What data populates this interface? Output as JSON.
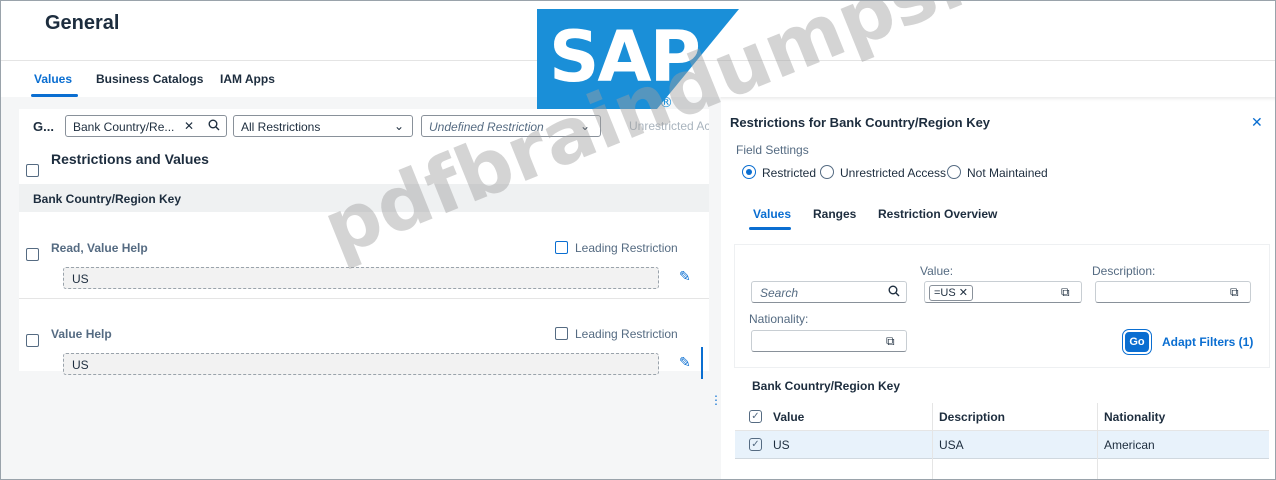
{
  "header": {
    "title": "General"
  },
  "tabs": [
    {
      "label": "Values",
      "active": true
    },
    {
      "label": "Business Catalogs",
      "active": false
    },
    {
      "label": "IAM Apps",
      "active": false
    }
  ],
  "left": {
    "group_label": "G...",
    "field_filter": "Bank Country/Re...",
    "restriction_filter": "All Restrictions",
    "restriction_type": "Undefined Restriction",
    "unrestricted_label": "Unrestricted Access",
    "list_title": "Restrictions and Values",
    "key_label": "Bank Country/Region Key",
    "rows": [
      {
        "label": "Read, Value Help",
        "leading": "Leading Restriction",
        "value": "US"
      },
      {
        "label": "Value Help",
        "leading": "Leading Restriction",
        "value": "US"
      }
    ]
  },
  "right": {
    "title": "Restrictions for Bank Country/Region Key",
    "field_settings_label": "Field Settings",
    "radios": [
      {
        "label": "Restricted",
        "selected": true
      },
      {
        "label": "Unrestricted Access",
        "selected": false
      },
      {
        "label": "Not Maintained",
        "selected": false
      }
    ],
    "subtabs": [
      {
        "label": "Values",
        "active": true
      },
      {
        "label": "Ranges",
        "active": false
      },
      {
        "label": "Restriction Overview",
        "active": false
      }
    ],
    "filters": {
      "search_placeholder": "Search",
      "value_label": "Value:",
      "value_token": "=US",
      "description_label": "Description:",
      "nationality_label": "Nationality:",
      "go_label": "Go",
      "adapt_label": "Adapt Filters (1)"
    },
    "table": {
      "title": "Bank Country/Region Key",
      "columns": [
        "Value",
        "Description",
        "Nationality"
      ],
      "rows": [
        {
          "value": "US",
          "description": "USA",
          "nationality": "American",
          "selected": true
        }
      ]
    }
  },
  "logo": {
    "text": "SAP",
    "registered": "®",
    "color": "#1a8fd8"
  },
  "watermark": {
    "text": "pdfbraindumps.com"
  },
  "colors": {
    "accent": "#0a6ed1",
    "text": "#1d2d3e",
    "muted": "#556b82"
  }
}
